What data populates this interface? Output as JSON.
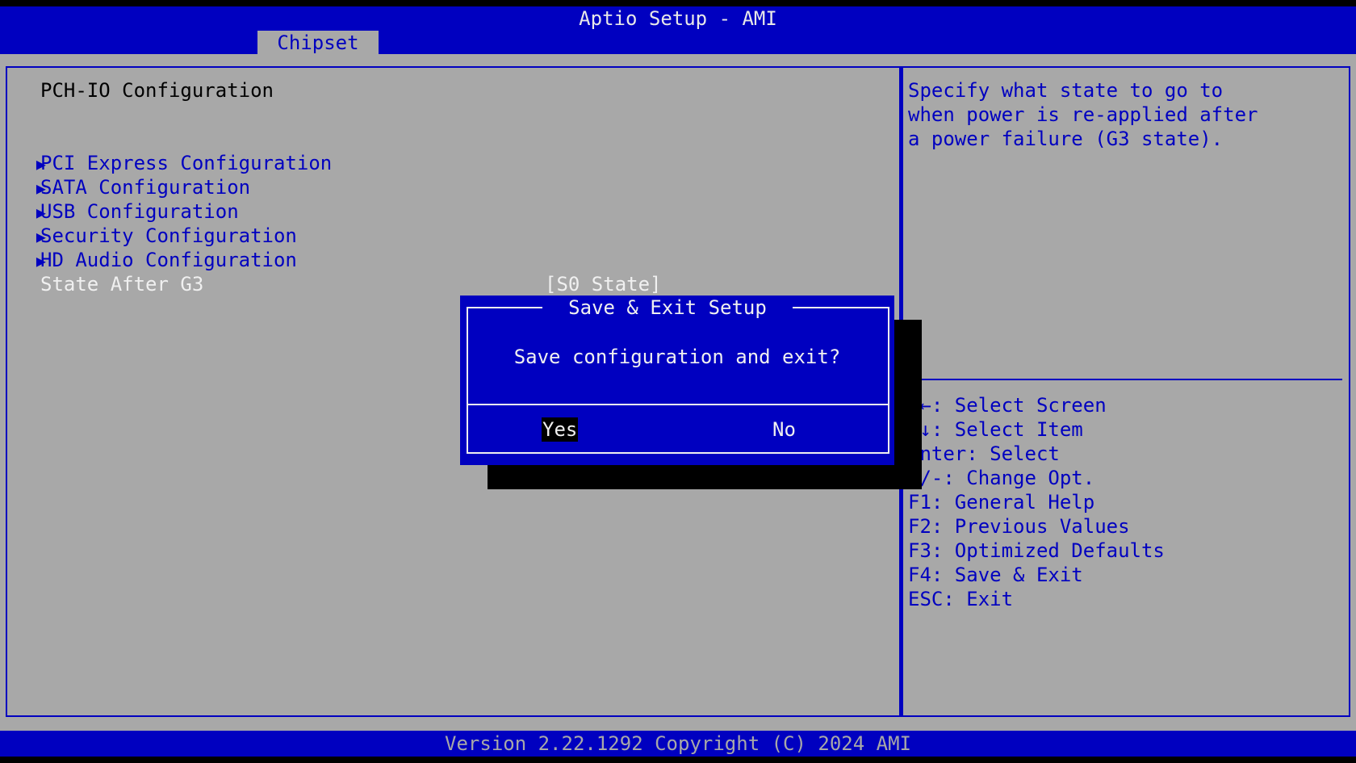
{
  "header": {
    "title": "Aptio Setup - AMI",
    "active_tab": "Chipset"
  },
  "left": {
    "section_title": "PCH-IO Configuration",
    "submenus": [
      "PCI Express Configuration",
      "SATA Configuration",
      "USB Configuration",
      "Security Configuration",
      "HD Audio Configuration"
    ],
    "setting": {
      "label": "State After G3",
      "value": "[S0 State]"
    }
  },
  "help": {
    "lines": [
      "Specify what state to go to",
      "when power is re-applied after",
      "a power failure (G3 state)."
    ]
  },
  "keys": [
    "→←: Select Screen",
    "↑↓: Select Item",
    "Enter: Select",
    "+/-: Change Opt.",
    "F1: General Help",
    "F2: Previous Values",
    "F3: Optimized Defaults",
    "F4: Save & Exit",
    "ESC: Exit"
  ],
  "dialog": {
    "title": "Save & Exit Setup",
    "message": "Save configuration and exit?",
    "yes": "Yes",
    "no": "No"
  },
  "footer": {
    "version": "Version 2.22.1292 Copyright (C) 2024 AMI"
  },
  "colors": {
    "bios_blue": "#0000c0",
    "bios_gray": "#a8a8a8",
    "text_white": "#f0f0f0"
  }
}
